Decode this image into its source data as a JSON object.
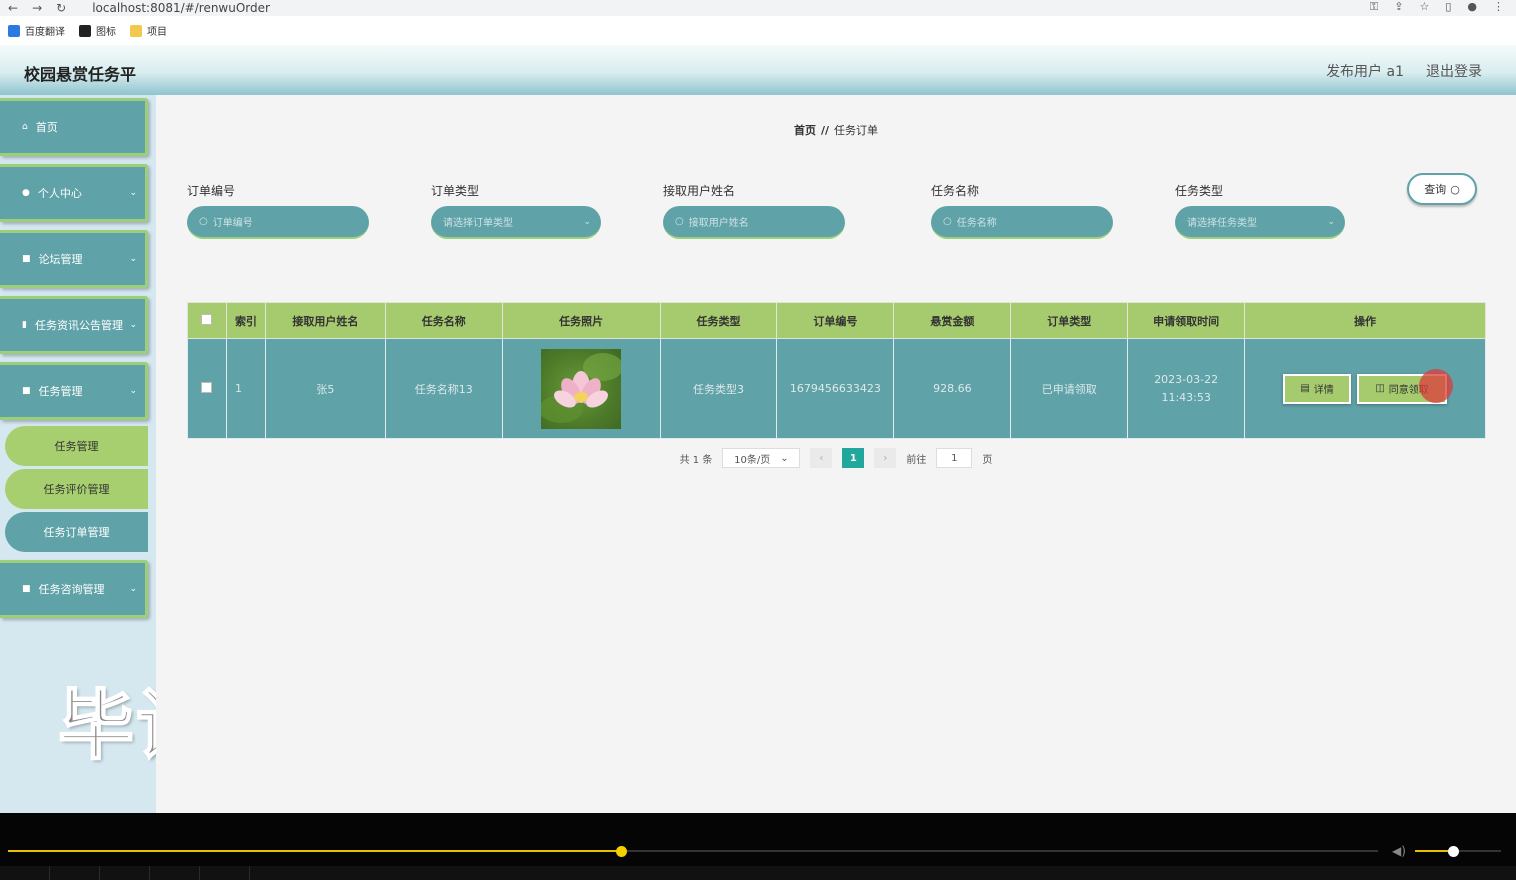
{
  "browser": {
    "url": "localhost:8081/#/renwuOrder"
  },
  "bookmarks": [
    "百度翻译",
    "图标",
    "项目"
  ],
  "header": {
    "title": "校园悬赏任务平",
    "user_label": "发布用户 a1",
    "logout": "退出登录"
  },
  "sidebar": {
    "items": [
      {
        "label": "首页"
      },
      {
        "label": "个人中心"
      },
      {
        "label": "论坛管理"
      },
      {
        "label": "任务资讯公告管理"
      },
      {
        "label": "任务管理"
      },
      {
        "label": "任务咨询管理"
      }
    ],
    "sub_items": [
      {
        "label": "任务管理"
      },
      {
        "label": "任务评价管理"
      },
      {
        "label": "任务订单管理"
      }
    ]
  },
  "watermark": "毕设代做",
  "breadcrumb": {
    "home": "首页",
    "sep": "//",
    "current": "任务订单"
  },
  "filters": [
    {
      "label": "订单编号",
      "placeholder": "订单编号",
      "type": "input"
    },
    {
      "label": "订单类型",
      "placeholder": "请选择订单类型",
      "type": "select"
    },
    {
      "label": "接取用户姓名",
      "placeholder": "接取用户姓名",
      "type": "input"
    },
    {
      "label": "任务名称",
      "placeholder": "任务名称",
      "type": "input"
    },
    {
      "label": "任务类型",
      "placeholder": "请选择任务类型",
      "type": "select"
    }
  ],
  "query_button": "查询",
  "table": {
    "headers": [
      "索引",
      "接取用户姓名",
      "任务名称",
      "任务照片",
      "任务类型",
      "订单编号",
      "悬赏金额",
      "订单类型",
      "申请领取时间",
      "操作"
    ],
    "rows": [
      {
        "index": "1",
        "user": "张5",
        "task_name": "任务名称13",
        "task_type": "任务类型3",
        "order_no": "1679456633423",
        "reward": "928.66",
        "order_type": "已申请领取",
        "apply_time": "2023-03-22 11:43:53",
        "actions": {
          "detail": "详情",
          "agree": "同意领取"
        }
      }
    ]
  },
  "pagination": {
    "total": "共 1 条",
    "page_size": "10条/页",
    "current": "1",
    "goto_prefix": "前往",
    "goto_value": "1",
    "goto_suffix": "页"
  },
  "colors": {
    "teal": "#5fa2a8",
    "green": "#a6cb6e",
    "page_active": "#21a79b"
  }
}
